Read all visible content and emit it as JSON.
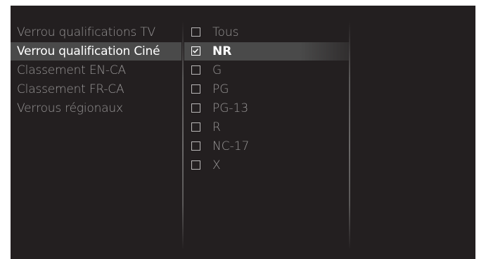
{
  "menu": {
    "left_items": [
      {
        "label": "Verrou qualifications TV",
        "selected": false
      },
      {
        "label": "Verrou qualification Ciné",
        "selected": true
      },
      {
        "label": "Classement EN-CA",
        "selected": false
      },
      {
        "label": "Classement FR-CA",
        "selected": false
      },
      {
        "label": "Verrous régionaux",
        "selected": false
      }
    ]
  },
  "ratings": {
    "options": [
      {
        "label": "Tous",
        "checked": false,
        "selected": false
      },
      {
        "label": "NR",
        "checked": true,
        "selected": true
      },
      {
        "label": "G",
        "checked": false,
        "selected": false
      },
      {
        "label": "PG",
        "checked": false,
        "selected": false
      },
      {
        "label": "PG-13",
        "checked": false,
        "selected": false
      },
      {
        "label": "R",
        "checked": false,
        "selected": false
      },
      {
        "label": "NC-17",
        "checked": false,
        "selected": false
      },
      {
        "label": "X",
        "checked": false,
        "selected": false
      }
    ]
  },
  "colors": {
    "background": "#231f20",
    "highlight": "#4a4a4a",
    "text_normal": "#9a9898",
    "text_selected": "#ffffff"
  }
}
